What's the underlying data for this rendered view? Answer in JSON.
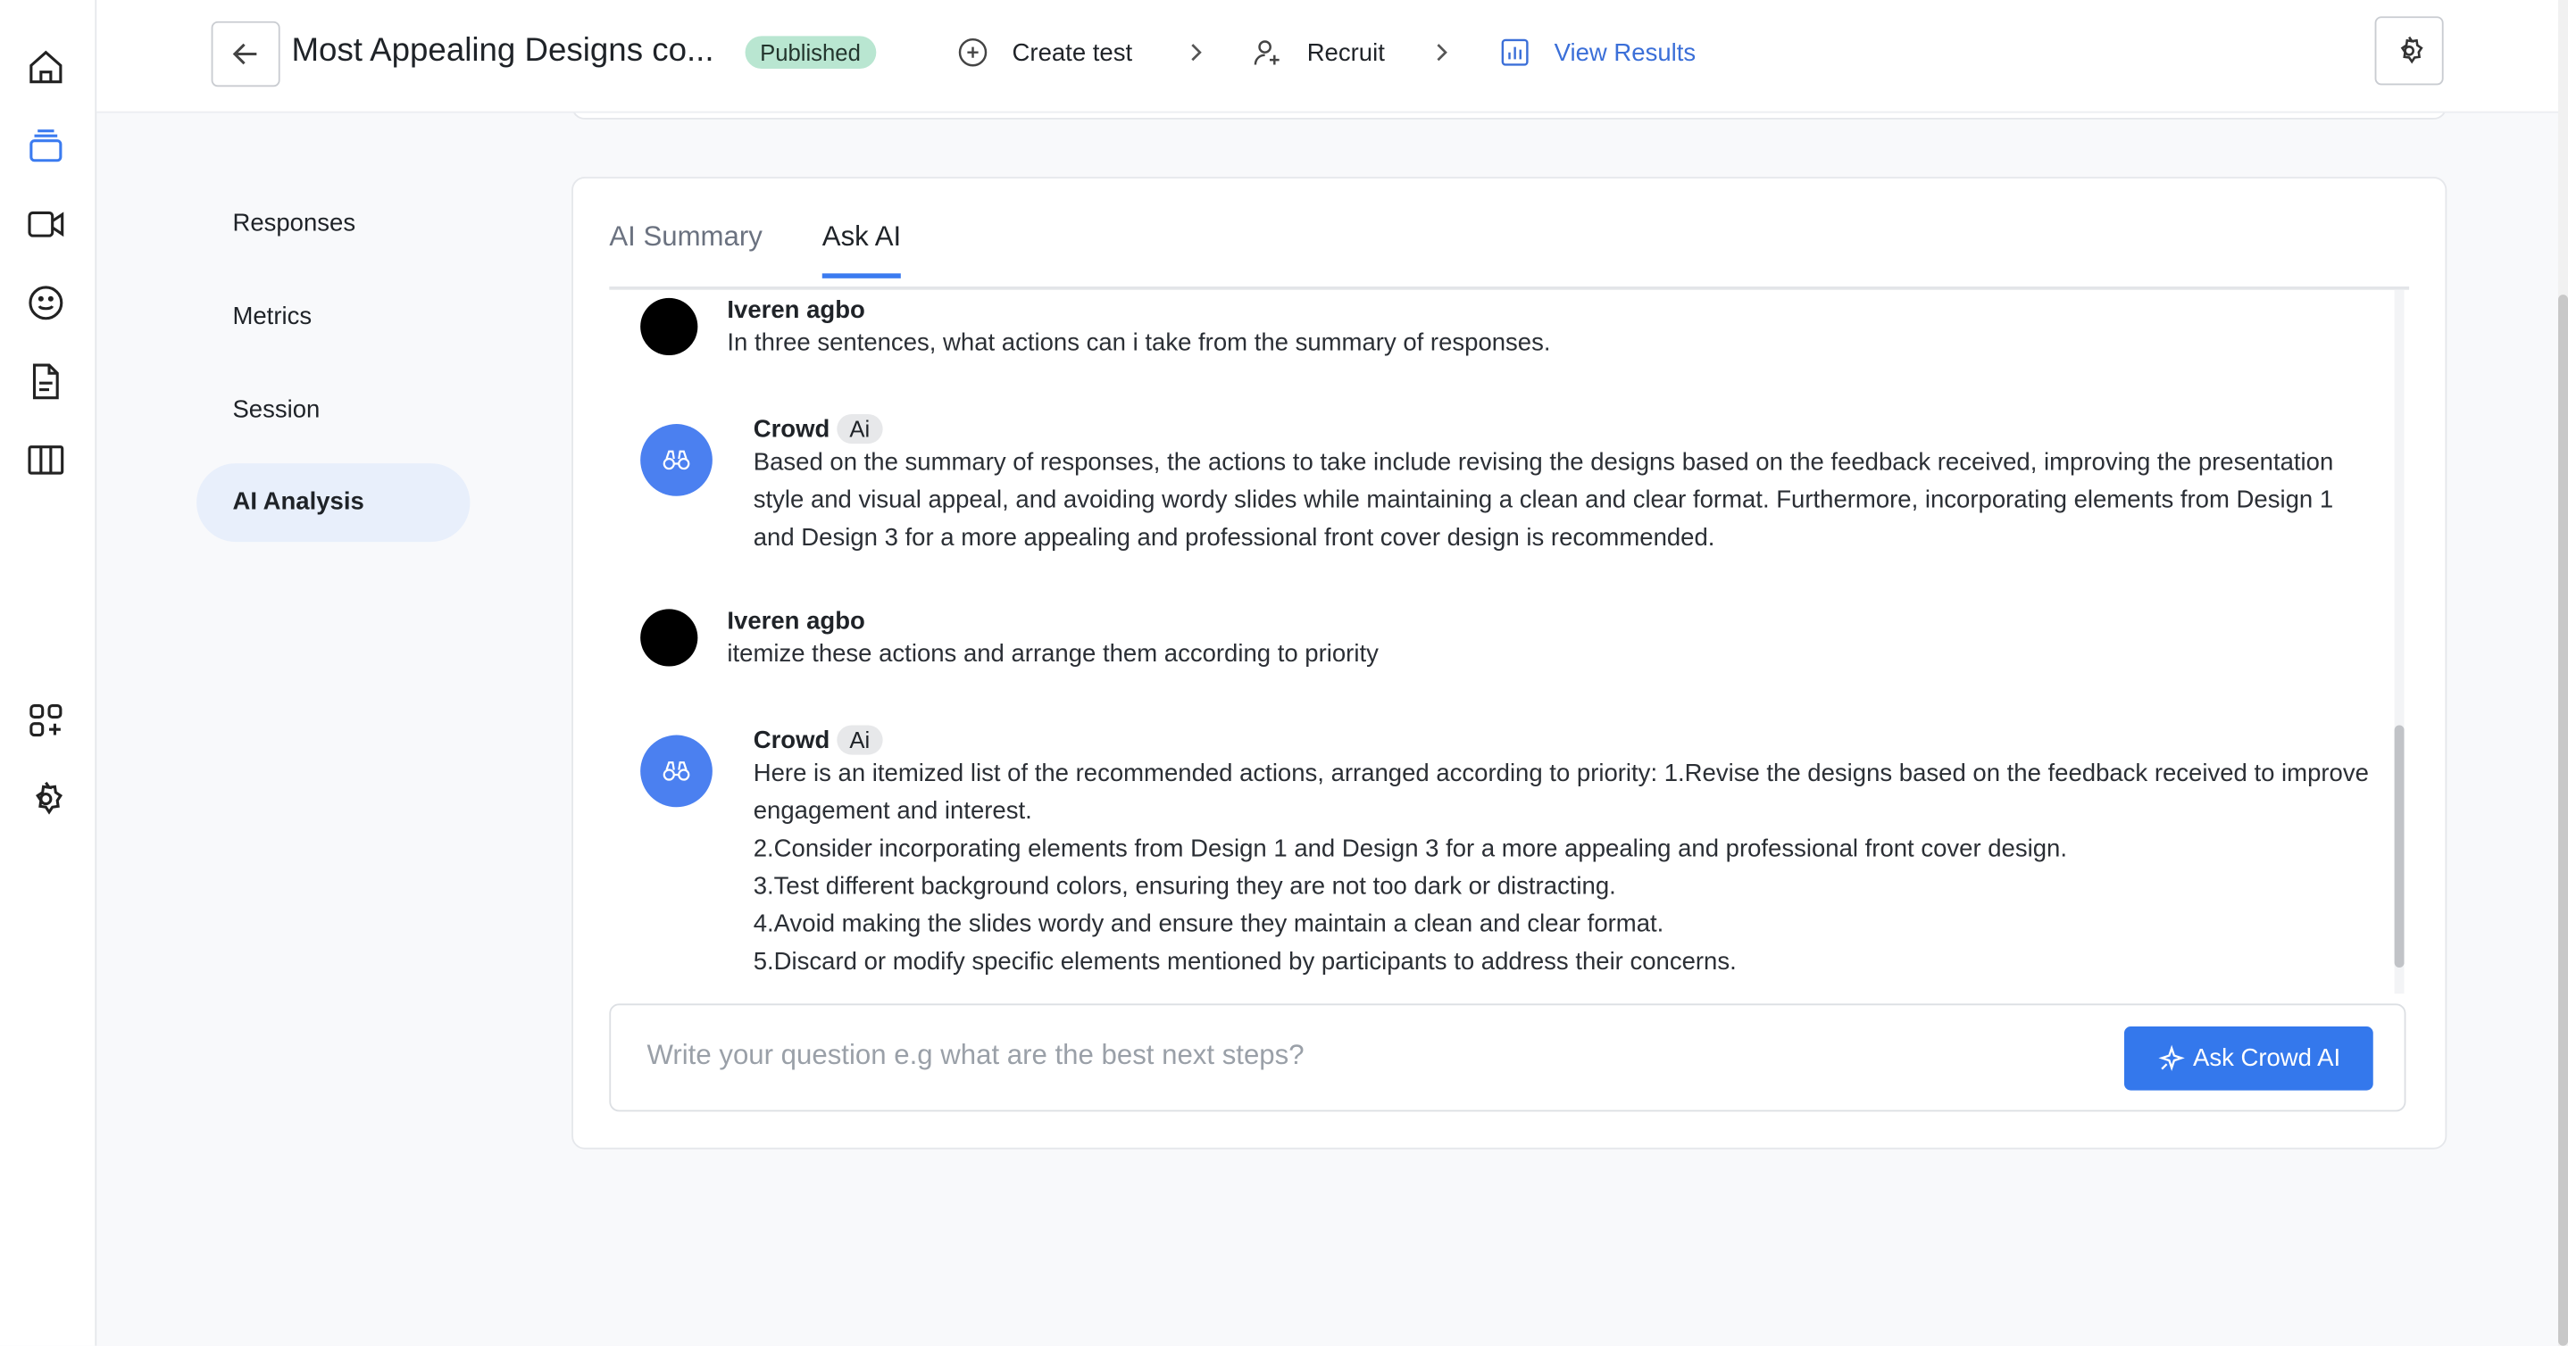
{
  "rail": {
    "icons": [
      "home-icon",
      "layers-icon",
      "video-icon",
      "smiley-icon",
      "document-icon",
      "columns-icon",
      "apps-add-icon",
      "settings-icon"
    ]
  },
  "header": {
    "title": "Most Appealing Designs co...",
    "status": "Published",
    "steps": [
      {
        "label": "Create test",
        "icon": "plus-circle-icon"
      },
      {
        "label": "Recruit",
        "icon": "user-plus-icon"
      },
      {
        "label": "View Results",
        "icon": "chart-icon"
      }
    ],
    "accent": "#3b7bf0"
  },
  "sidebar": {
    "items": [
      {
        "label": "Responses"
      },
      {
        "label": "Metrics"
      },
      {
        "label": "Session"
      },
      {
        "label": "AI Analysis",
        "active": true
      }
    ]
  },
  "tabs": [
    {
      "label": "AI Summary"
    },
    {
      "label": "Ask AI",
      "active": true
    }
  ],
  "messages": [
    {
      "author": "Iveren agbo",
      "text": "In three sentences, what actions can i take from the summary of responses."
    },
    {
      "author": "Crowd",
      "tag": "Ai",
      "text": "Based on the summary of responses, the actions to take include revising the designs based on the feedback received, improving the presentation style and visual appeal, and avoiding wordy slides while maintaining a clean and clear format. Furthermore, incorporating elements from Design 1 and Design 3 for a more appealing and professional front cover design is recommended."
    },
    {
      "author": "Iveren agbo",
      "text": "itemize these actions and arrange them according to priority"
    },
    {
      "author": "Crowd",
      "tag": "Ai",
      "lines": [
        "Here is an itemized list of the recommended actions, arranged according to priority: 1.Revise the designs based on the feedback received to improve engagement and interest.",
        "2.Consider incorporating elements from Design 1 and Design 3 for a more appealing and professional front cover design.",
        "3.Test different background colors, ensuring they are not too dark or distracting.",
        "4.Avoid making the slides wordy and ensure they maintain a clean and clear format.",
        "5.Discard or modify specific elements mentioned by participants to address their concerns."
      ]
    }
  ],
  "composer": {
    "placeholder": "Write your question e.g what are the best next steps?",
    "button": "Ask Crowd AI"
  }
}
